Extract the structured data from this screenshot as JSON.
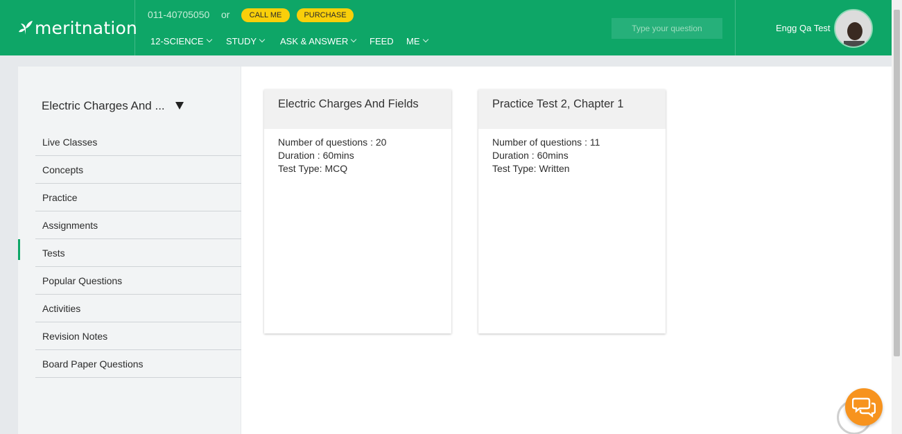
{
  "header": {
    "logo_text": "meritnation",
    "phone": "011-40705050",
    "or_text": "or",
    "call_me_label": "CALL ME",
    "purchase_label": "PURCHASE",
    "nav": [
      {
        "label": "12-SCIENCE"
      },
      {
        "label": "STUDY"
      },
      {
        "label": "ASK & ANSWER"
      },
      {
        "label": "FEED"
      },
      {
        "label": "ME"
      }
    ],
    "search_placeholder": "Type your question",
    "username": "Engg Qa Test",
    "colors": {
      "brand": "#0ea667",
      "pill": "#f9cf0a"
    }
  },
  "sidebar": {
    "chapter_select": "Electric Charges And ...",
    "items": [
      {
        "label": "Live Classes"
      },
      {
        "label": "Concepts"
      },
      {
        "label": "Practice"
      },
      {
        "label": "Assignments"
      },
      {
        "label": "Tests",
        "active": true
      },
      {
        "label": "Popular Questions"
      },
      {
        "label": "Activities"
      },
      {
        "label": "Revision Notes"
      },
      {
        "label": "Board Paper Questions"
      }
    ]
  },
  "cards": [
    {
      "title": "Electric Charges And Fields",
      "questions": "Number of questions : 20",
      "duration": "Duration : 60mins",
      "type": "Test Type: MCQ"
    },
    {
      "title": "Practice Test 2, Chapter 1",
      "questions": "Number of questions : 11",
      "duration": "Duration : 60mins",
      "type": "Test Type: Written"
    }
  ],
  "chat": {
    "icon": "chat-bubbles-icon",
    "color": "#f7931e"
  }
}
